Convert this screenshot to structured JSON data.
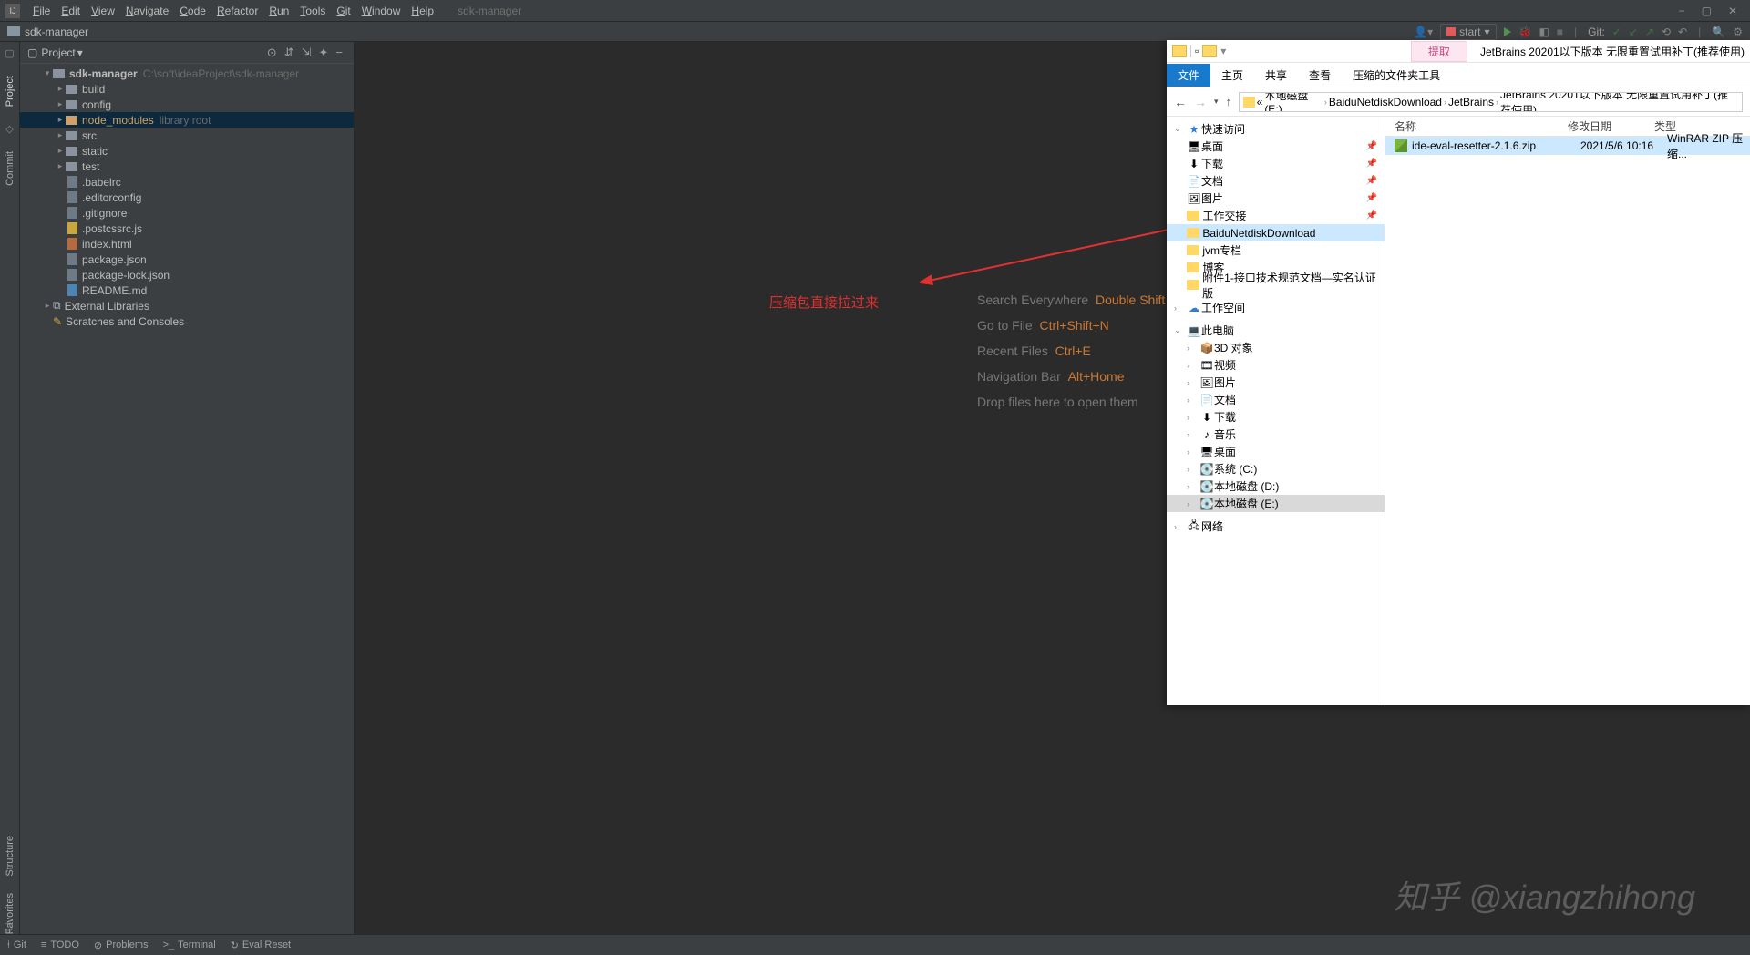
{
  "menubar": {
    "items": [
      "File",
      "Edit",
      "View",
      "Navigate",
      "Code",
      "Refactor",
      "Run",
      "Tools",
      "Git",
      "Window",
      "Help"
    ],
    "title_hint": "sdk-manager"
  },
  "breadcrumb": {
    "text": "sdk-manager"
  },
  "toolbar_right": {
    "git_label": "Git:",
    "run_config": "start"
  },
  "project_header": {
    "label": "Project"
  },
  "tree": {
    "root": {
      "name": "sdk-manager",
      "path": "C:\\soft\\ideaProject\\sdk-manager"
    },
    "folders": [
      "build",
      "config",
      "node_modules",
      "src",
      "static",
      "test"
    ],
    "node_modules_hint": "library root",
    "files": [
      {
        "n": ".babelrc",
        "t": "file"
      },
      {
        "n": ".editorconfig",
        "t": "file"
      },
      {
        "n": ".gitignore",
        "t": "file"
      },
      {
        "n": ".postcssrc.js",
        "t": "js"
      },
      {
        "n": "index.html",
        "t": "html"
      },
      {
        "n": "package.json",
        "t": "file"
      },
      {
        "n": "package-lock.json",
        "t": "file"
      },
      {
        "n": "README.md",
        "t": "md"
      }
    ],
    "external": "External Libraries",
    "scratches": "Scratches and Consoles"
  },
  "editor_hints": [
    {
      "label": "Search Everywhere",
      "key": "Double Shift"
    },
    {
      "label": "Go to File",
      "key": "Ctrl+Shift+N"
    },
    {
      "label": "Recent Files",
      "key": "Ctrl+E"
    },
    {
      "label": "Navigation Bar",
      "key": "Alt+Home"
    },
    {
      "label": "Drop files here to open them",
      "key": ""
    }
  ],
  "annotation": "压缩包直接拉过来",
  "explorer": {
    "window_title": "JetBrains 20201以下版本 无限重置试用补丁(推荐使用)",
    "extract_tab": "提取",
    "ribbon": [
      "文件",
      "主页",
      "共享",
      "查看",
      "压缩的文件夹工具"
    ],
    "path": [
      "本地磁盘 (E:)",
      "BaiduNetdiskDownload",
      "JetBrains",
      "JetBrains 20201以下版本 无限重置试用补丁(推荐使用)"
    ],
    "columns": [
      "名称",
      "修改日期",
      "类型"
    ],
    "item": {
      "name": "ide-eval-resetter-2.1.6.zip",
      "date": "2021/5/6 10:16",
      "type": "WinRAR ZIP 压缩..."
    },
    "side": {
      "quick": "快速访问",
      "pinned": [
        "桌面",
        "下载",
        "文档",
        "图片",
        "工作交接",
        "BaiduNetdiskDownload",
        "jvm专栏",
        "博客",
        "附件1-接口技术规范文档—实名认证版"
      ],
      "workspace": "工作空间",
      "thispc": "此电脑",
      "thispc_items": [
        "3D 对象",
        "视频",
        "图片",
        "文档",
        "下载",
        "音乐",
        "桌面",
        "系统 (C:)",
        "本地磁盘 (D:)",
        "本地磁盘 (E:)"
      ],
      "network": "网络"
    }
  },
  "left_tabs": [
    "Project",
    "Commit",
    "Structure",
    "Favorites"
  ],
  "bottombar": {
    "items": [
      {
        "icon": "⍿",
        "label": "Git"
      },
      {
        "icon": "≡",
        "label": "TODO"
      },
      {
        "icon": "⊘",
        "label": "Problems"
      },
      {
        "icon": ">_",
        "label": "Terminal"
      },
      {
        "icon": "↻",
        "label": "Eval Reset"
      }
    ]
  },
  "watermark": "知乎 @xiangzhihong"
}
